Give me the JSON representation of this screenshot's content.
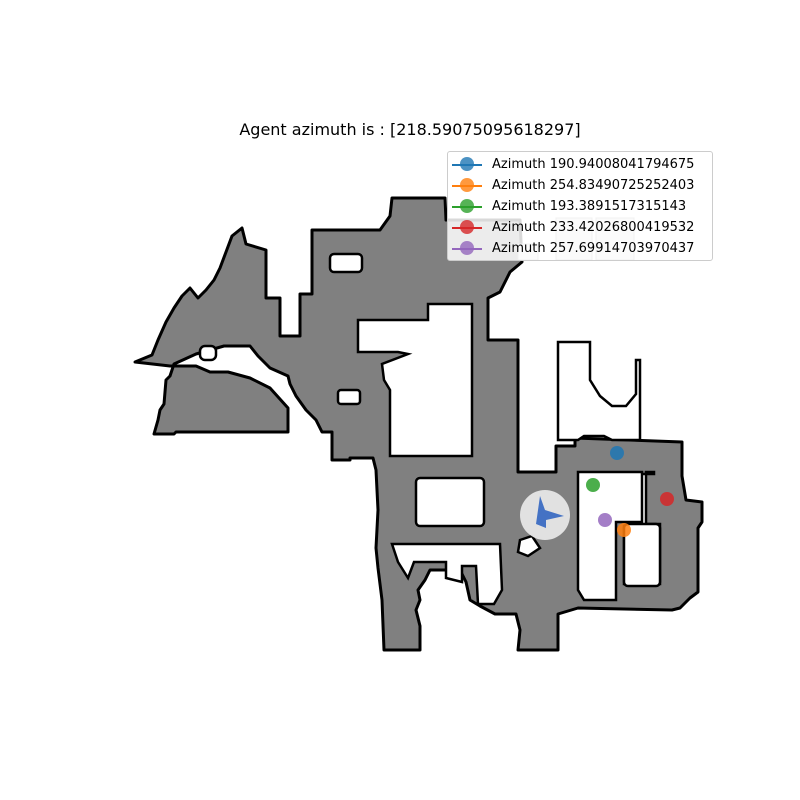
{
  "title": "Agent azimuth is : [218.59075095618297]",
  "map_colors": {
    "free": "#808080",
    "wall": "#000000",
    "unknown": "#ffffff",
    "agent": "#4472c4",
    "agent_halo": "#e6e6e6"
  },
  "agent": {
    "azimuth": 218.59075095618297,
    "icon": "agent-arrow-icon"
  },
  "legend": {
    "placement": "top-right",
    "items": [
      {
        "label": "Azimuth 190.94008041794675",
        "color": "#1f77b4"
      },
      {
        "label": "Azimuth 254.83490725252403",
        "color": "#ff7f0e"
      },
      {
        "label": "Azimuth 193.3891517315143",
        "color": "#2ca02c"
      },
      {
        "label": "Azimuth 233.42026800419532",
        "color": "#d62728"
      },
      {
        "label": "Azimuth 257.69914703970437",
        "color": "#9467bd"
      }
    ]
  }
}
